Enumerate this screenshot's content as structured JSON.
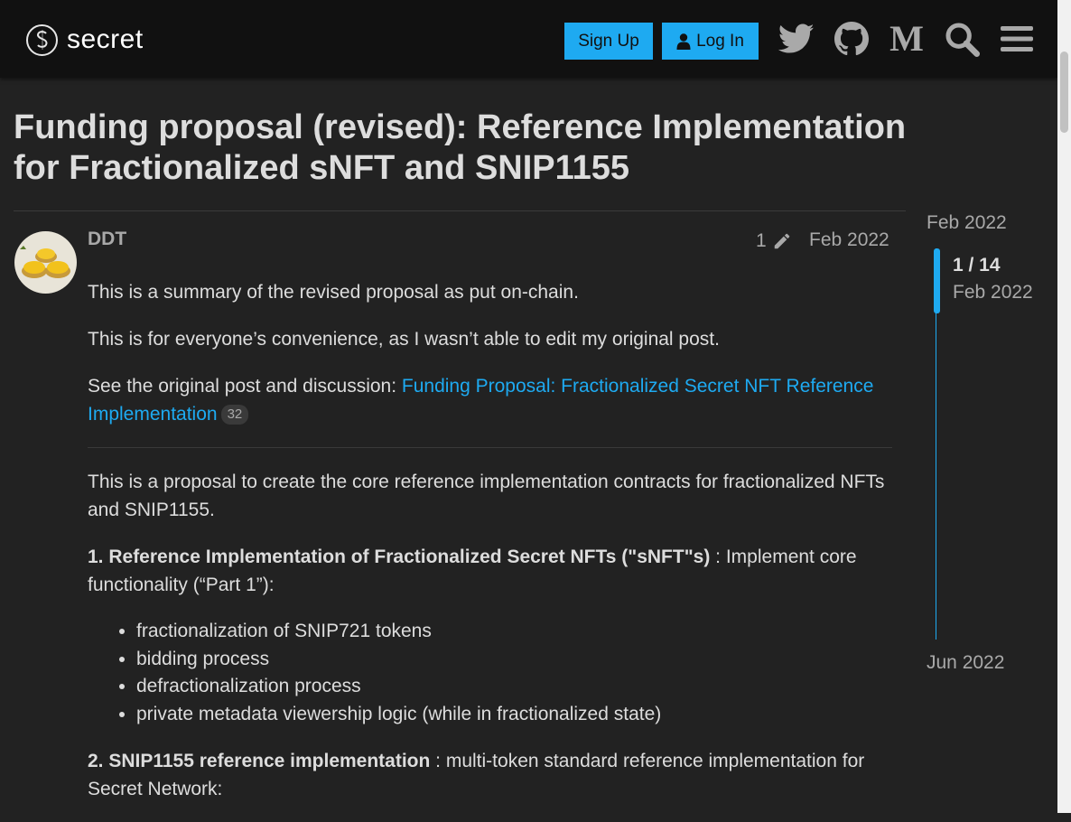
{
  "header": {
    "logo_text": "secret",
    "signup_label": "Sign Up",
    "login_label": "Log In",
    "icons": [
      "twitter-icon",
      "github-icon",
      "medium-icon",
      "search-icon",
      "hamburger-menu-icon"
    ],
    "medium_letter": "M"
  },
  "colors": {
    "accent": "#1eaaf1",
    "background": "#222222",
    "header_background": "#111111",
    "text": "#dddddd",
    "muted_text": "#a9a9a9"
  },
  "topic": {
    "title": "Funding proposal (revised): Reference Implementation for Fractionalized sNFT and SNIP1155"
  },
  "post": {
    "username": "DDT",
    "edit_count": "1",
    "date": "Feb 2022",
    "p1": "This is a summary of the revised proposal as put on-chain.",
    "p2": "This is for everyone’s convenience, as I wasn’t able to edit my original post.",
    "p3_prefix": "See the original post and discussion: ",
    "p3_link": "Funding Proposal: Fractionalized Secret NFT Reference Implementation",
    "p3_link_clicks": "32",
    "p4": "This is a proposal to create the core reference implementation contracts for fractionalized NFTs and SNIP1155.",
    "section1_heading": "1. Reference Implementation of Fractionalized Secret NFTs (\"sNFT\"s)",
    "section1_rest": " : Implement core functionality (“Part 1”):",
    "section1_items": [
      "fractionalization of SNIP721 tokens",
      "bidding process",
      "defractionalization process",
      "private metadata viewership logic (while in fractionalized state)"
    ],
    "section2_heading": "2. SNIP1155 reference implementation",
    "section2_rest": " : multi-token standard reference implementation for Secret Network:"
  },
  "timeline": {
    "top_date": "Feb 2022",
    "position": "1 / 14",
    "position_date": "Feb 2022",
    "bottom_date": "Jun 2022",
    "current_post": 1,
    "total_posts": 14
  }
}
